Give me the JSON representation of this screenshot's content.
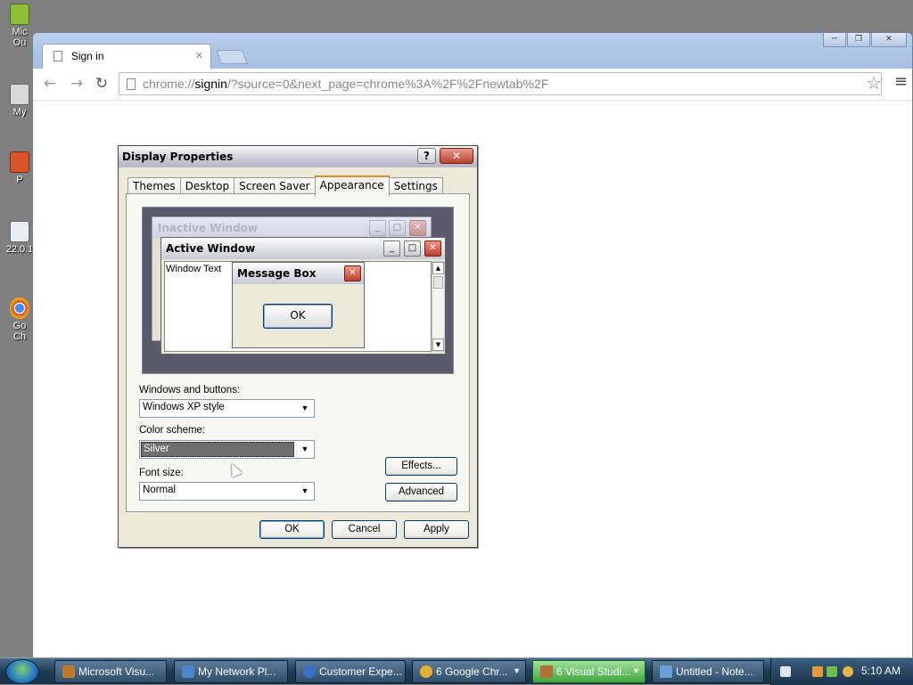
{
  "desktop": {
    "icons": [
      {
        "label": "Mic\nOu"
      },
      {
        "label": "My"
      },
      {
        "label": "P"
      },
      {
        "label": "22.0.1"
      },
      {
        "label": "Go\nCh"
      }
    ]
  },
  "browser": {
    "tab_title": "Sign in",
    "tab_close": "✕",
    "url_scheme": "chrome://",
    "url_host": "signin",
    "url_rest": "/?source=0&next_page=chrome%3A%2F%2Fnewtab%2F",
    "window_controls": [
      "─",
      "❐",
      "✕"
    ],
    "nav": {
      "back": "←",
      "forward": "→",
      "reload": "↻",
      "star": "☆",
      "menu": "≡"
    }
  },
  "dialog": {
    "title": "Display Properties",
    "help": "?",
    "close": "✕",
    "tabs": [
      "Themes",
      "Desktop",
      "Screen Saver",
      "Appearance",
      "Settings"
    ],
    "active_tab": "Appearance",
    "preview": {
      "inactive_title": "Inactive Window",
      "active_title": "Active Window",
      "window_text": "Window Text",
      "msgbox_title": "Message Box",
      "msgbox_ok": "OK",
      "glyph_min": "_",
      "glyph_max": "□",
      "glyph_close": "✕",
      "glyph_up": "▲",
      "glyph_down": "▼"
    },
    "windows_buttons_label": "Windows and buttons:",
    "windows_buttons_value": "Windows XP style",
    "color_scheme_label": "Color scheme:",
    "color_scheme_value": "Silver",
    "font_size_label": "Font size:",
    "font_size_value": "Normal",
    "caret": "▼",
    "effects_button": "Effects...",
    "advanced_button": "Advanced",
    "ok_button": "OK",
    "cancel_button": "Cancel",
    "apply_button": "Apply"
  },
  "taskbar": {
    "items": [
      {
        "label": "Microsoft Visu...",
        "icon_color": "#c0782c"
      },
      {
        "label": "My Network Pl...",
        "icon_color": "#4a86c8"
      },
      {
        "label": "Customer Expe...",
        "icon_color": "#3a6fc8"
      },
      {
        "label": "6 Google Chr...",
        "icon_color": "#e0b030",
        "drop": "▼"
      },
      {
        "label": "6 Visual Studi...",
        "icon_color": "#b07030",
        "drop": "▼",
        "active": true
      },
      {
        "label": "Untitled - Note...",
        "icon_color": "#6aa0d8"
      }
    ],
    "clock": "5:10 AM"
  },
  "colors": {
    "xp_selection": "#6f6f6f",
    "taskbar_active": "#3fa63d",
    "close_red": "#c23d2c",
    "tab_highlight": "#e68b2c"
  }
}
